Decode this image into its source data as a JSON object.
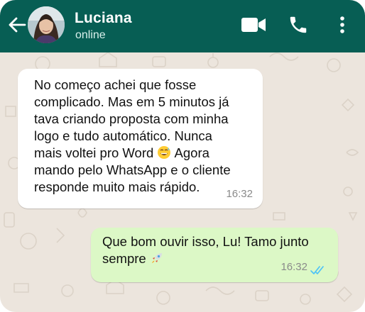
{
  "header": {
    "contact_name": "Luciana",
    "status": "online",
    "back_icon": "back-arrow-icon",
    "video_icon": "video-camera-icon",
    "call_icon": "phone-icon",
    "menu_icon": "more-vertical-icon",
    "bg_color": "#075e54"
  },
  "messages": [
    {
      "direction": "incoming",
      "text": "No começo achei que fosse\ncomplicado. Mas em 5 minutos já\ntava criando proposta com minha\nlogo e tudo automático. Nunca\nmais voltei pro Word",
      "emoji": "grinning-sweat-emoji",
      "text_after": " Agora\nmando pelo WhatsApp e o cliente\nresponde muito mais rápido.",
      "time": "16:32",
      "bubble_color": "#ffffff"
    },
    {
      "direction": "outgoing",
      "text": "Que bom ouvir isso, Lu! Tamo junto\nsempre ",
      "emoji": "rocket-emoji",
      "time": "16:32",
      "status": "read",
      "status_icon": "double-check-icon",
      "bubble_color": "#dcf8c6",
      "tick_color": "#4fc3f7"
    }
  ],
  "chat_background": "#ece5dd"
}
